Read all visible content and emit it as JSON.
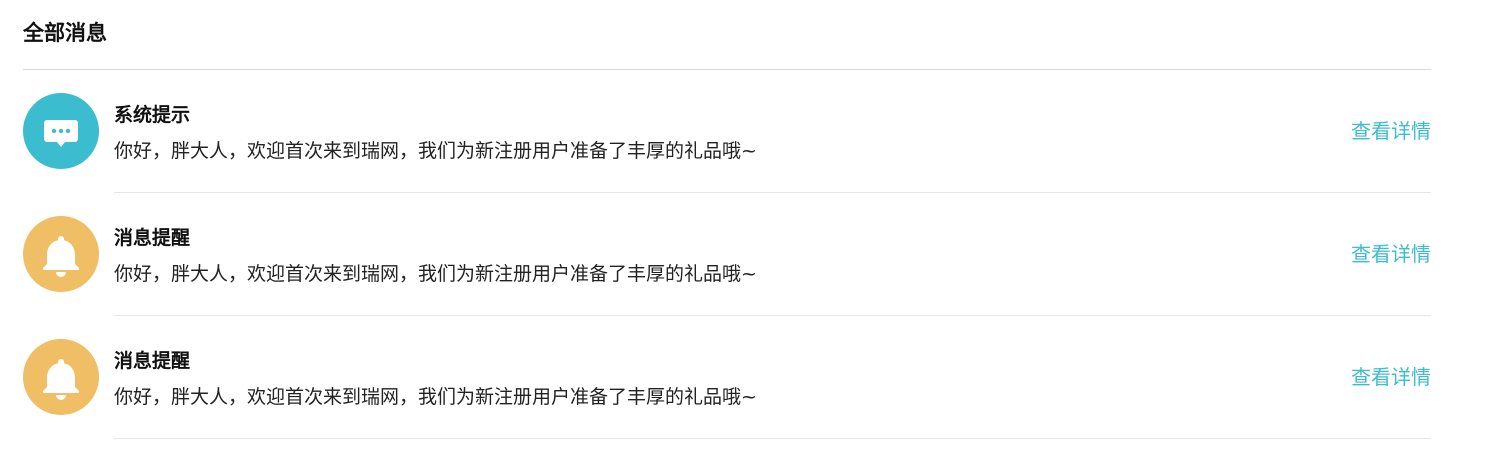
{
  "page": {
    "title": "全部消息"
  },
  "colors": {
    "system_icon_bg": "#3bbccf",
    "reminder_icon_bg": "#f0be64",
    "link": "#3dbccf"
  },
  "messages": [
    {
      "icon": "chat-bubble-icon",
      "title": "系统提示",
      "text": "你好，胖大人，欢迎首次来到瑞网，我们为新注册用户准备了丰厚的礼品哦~",
      "link_label": "查看详情"
    },
    {
      "icon": "bell-icon",
      "title": "消息提醒",
      "text": "你好，胖大人，欢迎首次来到瑞网，我们为新注册用户准备了丰厚的礼品哦~",
      "link_label": "查看详情"
    },
    {
      "icon": "bell-icon",
      "title": "消息提醒",
      "text": "你好，胖大人，欢迎首次来到瑞网，我们为新注册用户准备了丰厚的礼品哦~",
      "link_label": "查看详情"
    }
  ]
}
